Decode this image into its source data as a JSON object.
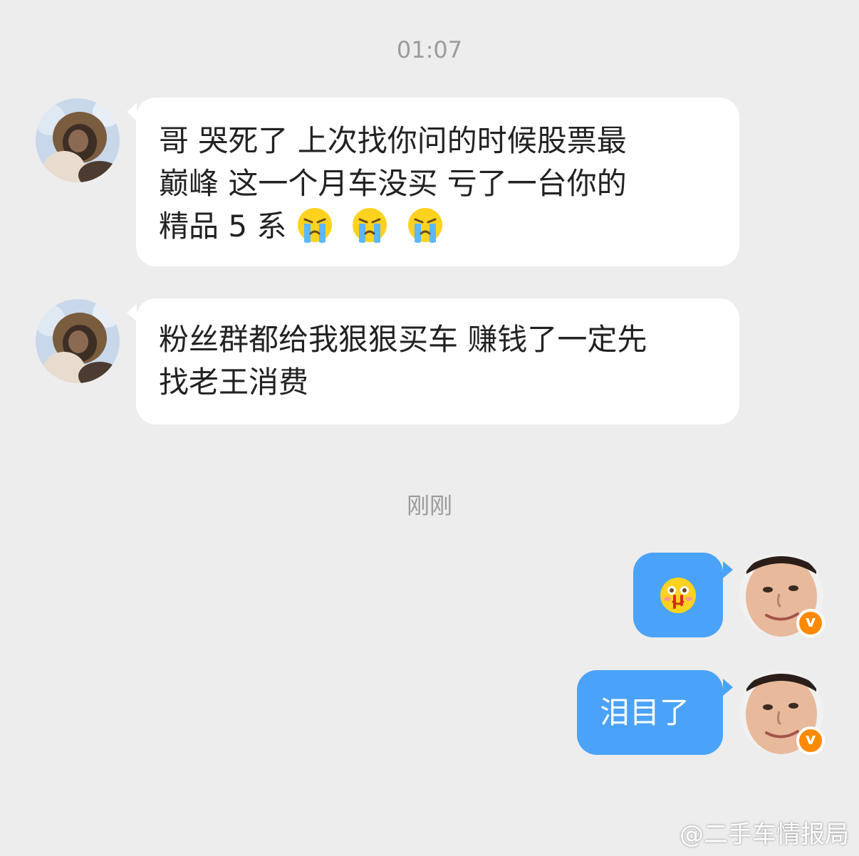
{
  "timestamps": {
    "first": "01:07",
    "second": "刚刚"
  },
  "messages": [
    {
      "side": "incoming",
      "lines": [
        "哥 哭死了 上次找你问的时候股票最",
        "巅峰 这一个月车没买 亏了一台你的"
      ],
      "last_line": "精品 5 系",
      "emojis": [
        "crying-emoji",
        "crying-emoji",
        "crying-emoji"
      ]
    },
    {
      "side": "incoming",
      "lines": [
        "粉丝群都给我狠狠买车 赚钱了一定先",
        "找老王消费"
      ]
    },
    {
      "side": "outgoing",
      "emoji": "nosebleed-emoji"
    },
    {
      "side": "outgoing",
      "text": "泪目了"
    }
  ],
  "badge": {
    "label": "v",
    "color": "#ff8a00"
  },
  "colors": {
    "background": "#ededed",
    "incoming_bubble": "#ffffff",
    "outgoing_bubble": "#4aa3f8"
  },
  "watermark": "@二手车情报局"
}
